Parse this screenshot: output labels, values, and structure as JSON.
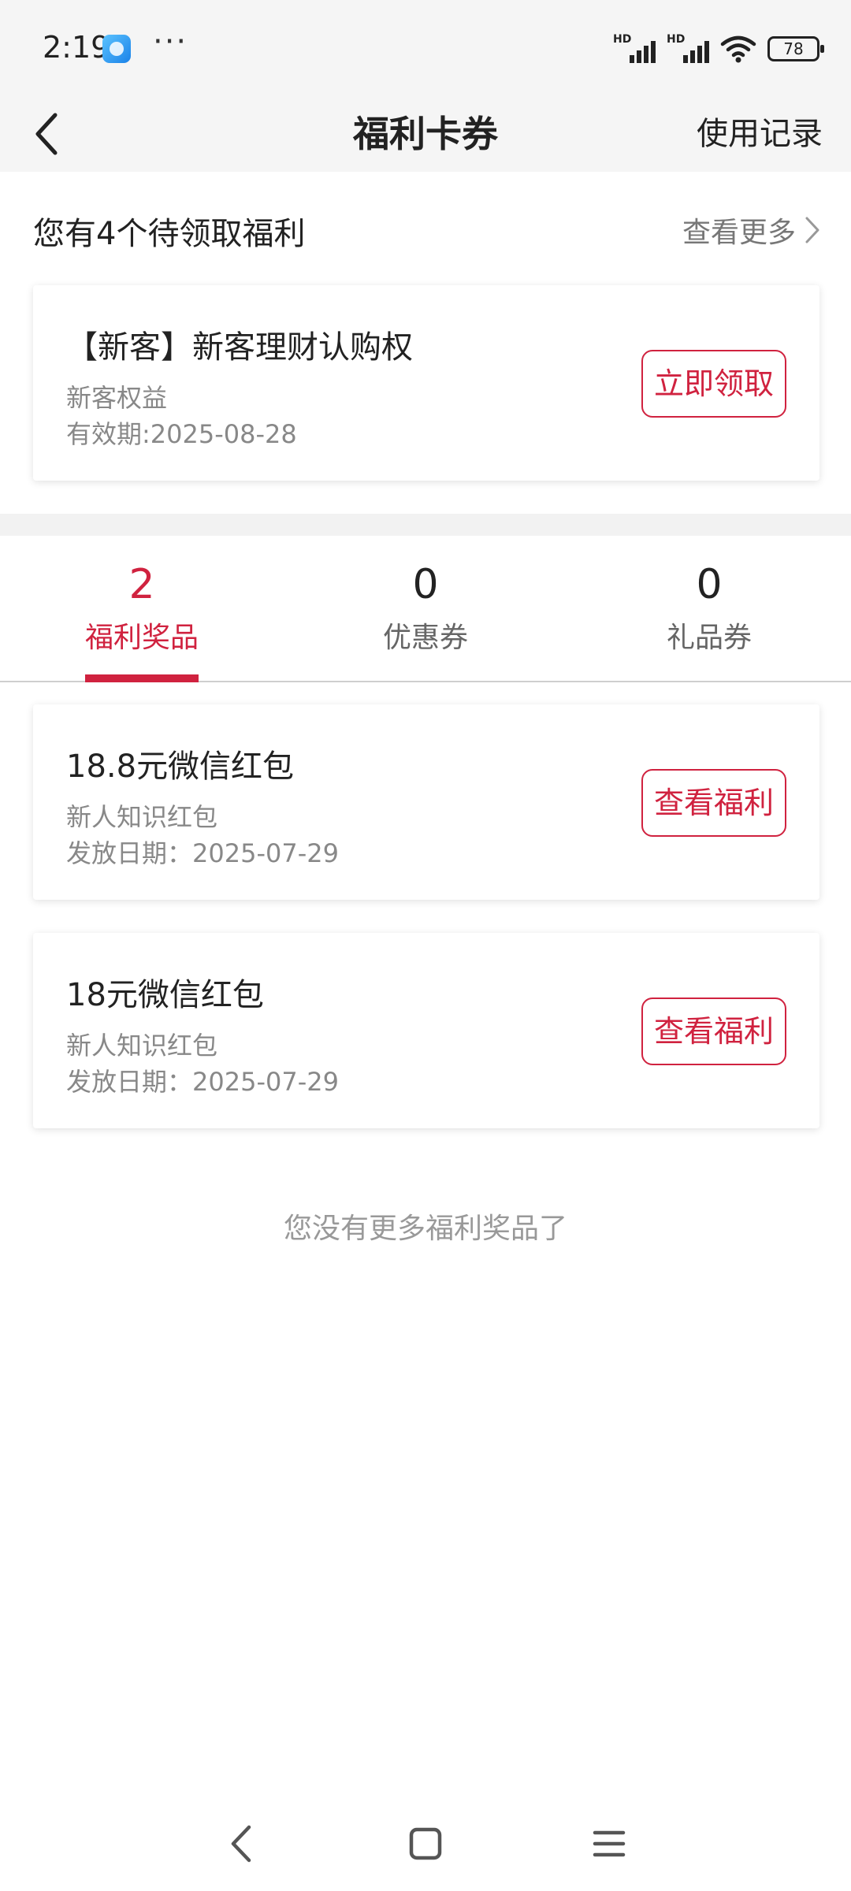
{
  "status_bar": {
    "time": "2:19",
    "dots": "···",
    "signal1_label": "HD",
    "signal2_label": "HD",
    "battery": "78"
  },
  "header": {
    "title": "福利卡券",
    "usage_record": "使用记录"
  },
  "pending": {
    "title": "您有4个待领取福利",
    "view_more": "查看更多",
    "card": {
      "title": "【新客】新客理财认购权",
      "subtitle": "新客权益",
      "validity": "有效期:2025-08-28",
      "button": "立即领取"
    }
  },
  "tabs": [
    {
      "count": "2",
      "label": "福利奖品",
      "active": true
    },
    {
      "count": "0",
      "label": "优惠券",
      "active": false
    },
    {
      "count": "0",
      "label": "礼品券",
      "active": false
    }
  ],
  "rewards": [
    {
      "title": "18.8元微信红包",
      "subtitle": "新人知识红包",
      "date": "发放日期：2025-07-29",
      "button": "查看福利"
    },
    {
      "title": "18元微信红包",
      "subtitle": "新人知识红包",
      "date": "发放日期：2025-07-29",
      "button": "查看福利"
    }
  ],
  "empty_note": "您没有更多福利奖品了",
  "icons": {
    "back": "chevron-left-icon",
    "more": "chevron-right-icon",
    "nav_back": "back-triangle-icon",
    "nav_home": "home-square-icon",
    "nav_menu": "menu-lines-icon"
  },
  "colors": {
    "accent": "#d0223f",
    "header_bg": "#f5f5f5",
    "separator": "#f2f2f2"
  }
}
